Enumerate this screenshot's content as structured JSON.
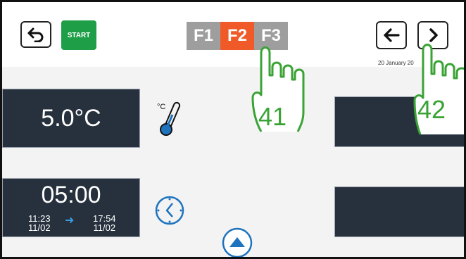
{
  "toolbar": {
    "back_icon": "back-arrow-icon",
    "start_label": "START"
  },
  "function_tabs": [
    {
      "label": "F1",
      "color": "#9e9e9e"
    },
    {
      "label": "F2",
      "color": "#f05a28",
      "selected": true
    },
    {
      "label": "F3",
      "color": "#9e9e9e"
    }
  ],
  "navigation": {
    "prev_icon": "arrow-left-icon",
    "next_icon": "chevron-right-icon",
    "date": "20 January 20"
  },
  "temperature": {
    "value": "5.0°C",
    "icon": "thermometer-icon",
    "unit_label": "°C"
  },
  "timer": {
    "duration": "05:00",
    "start_time": "11:23",
    "start_date": "11/02",
    "end_time": "17:54",
    "end_date": "11/02",
    "icon": "clock-icon"
  },
  "scroll": {
    "up_icon": "arrow-up-circle-icon"
  },
  "annotations": {
    "hand_41_label": "41",
    "hand_42_label": "42",
    "hand_icon": "pointing-hand-icon",
    "color": "#3aa335"
  },
  "colors": {
    "panel": "#26313d",
    "start": "#1e9f47",
    "accent": "#f05a28",
    "icon_blue": "#1e73be"
  }
}
